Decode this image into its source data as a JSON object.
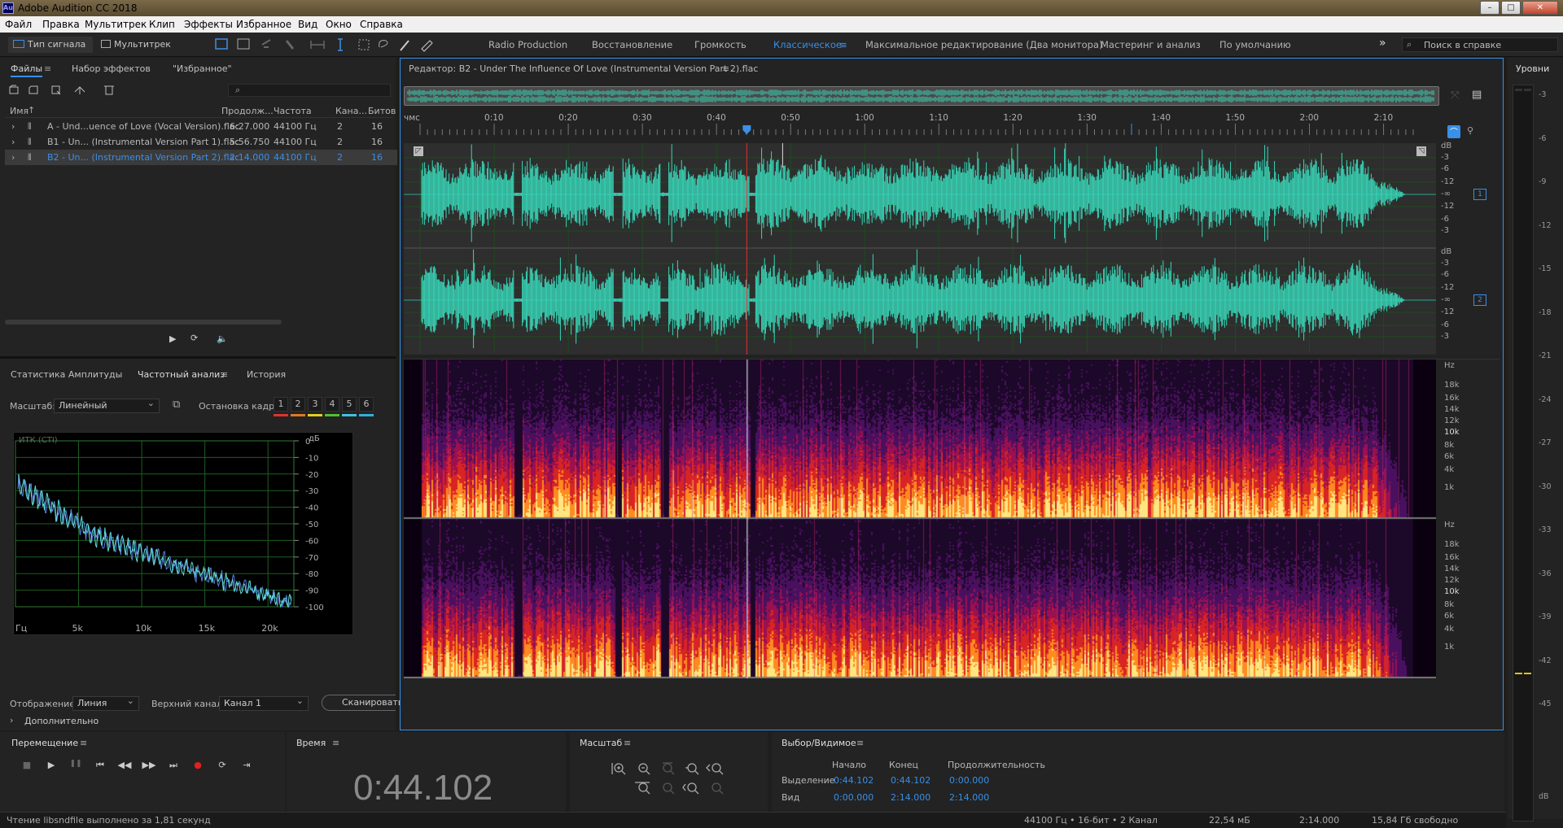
{
  "window": {
    "title": "Adobe Audition CC 2018",
    "app_icon": "Au",
    "buttons": [
      "–",
      "□",
      "✕"
    ]
  },
  "menu": [
    "Файл",
    "Правка",
    "Мультитрек",
    "Клип",
    "Эффекты",
    "Избранное",
    "Вид",
    "Окно",
    "Справка"
  ],
  "toolbar": {
    "waveform_label": "Тип сигнала",
    "multitrack_label": "Мультитрек",
    "workspaces": [
      "Radio Production",
      "Восстановление",
      "Громкость",
      "Классическое",
      "Максимальное редактирование (Два монитора)",
      "Мастеринг и анализ",
      "По умолчанию"
    ],
    "active_workspace": "Классическое",
    "overflow": "»",
    "search_placeholder": "Поиск в справке"
  },
  "files_panel": {
    "tabs": [
      "Файлы",
      "Набор эффектов",
      "\"Избранное\""
    ],
    "columns": [
      "Имя",
      "Продолж...",
      "Частота",
      "Кана...",
      "Битов"
    ],
    "rows": [
      {
        "name": "A - Und...uence of Love (Vocal Version).flac",
        "duration": "6:27.000",
        "rate": "44100 Гц",
        "channels": "2",
        "bits": "16"
      },
      {
        "name": "B1 - Un... (Instrumental Version Part 1).flac",
        "duration": "5:56.750",
        "rate": "44100 Гц",
        "channels": "2",
        "bits": "16"
      },
      {
        "name": "B2 - Un... (Instrumental Version Part 2).flac",
        "duration": "2:14.000",
        "rate": "44100 Гц",
        "channels": "2",
        "bits": "16"
      }
    ],
    "selected_row": 2,
    "search_icon": "⌕"
  },
  "analysis_panel": {
    "tabs": [
      "Статистика Амплитуды",
      "Частотный анализ",
      "История"
    ],
    "active_tab": "Частотный анализ",
    "scale_label": "Масштаб:",
    "scale_value": "Линейный",
    "freeze_label": "Остановка кадра:",
    "freeze_buttons": [
      "1",
      "2",
      "3",
      "4",
      "5",
      "6"
    ],
    "freeze_colors": [
      "#e03030",
      "#e07820",
      "#e0d020",
      "#50c030",
      "#40c0e0",
      "#30b0e0"
    ],
    "graph_label": "ИТК (CTI)",
    "db_label": "дБ",
    "db_ticks": [
      "0",
      "-10",
      "-20",
      "-30",
      "-40",
      "-50",
      "-60",
      "-70",
      "-80",
      "-90",
      "-100"
    ],
    "hz_ticks": [
      "Гц",
      "5k",
      "10k",
      "15k",
      "20k"
    ],
    "display_label": "Отображение:",
    "display_value": "Линия",
    "channel_label": "Верхний канал:",
    "channel_value": "Канал 1",
    "scan_button": "Сканировать",
    "more_label": "Дополнительно"
  },
  "editor": {
    "title": "Редактор: B2 - Under The Influence Of Love (Instrumental Version Part 2).flac",
    "time_ticks": [
      "чмс",
      "0:10",
      "0:20",
      "0:30",
      "0:40",
      "0:50",
      "1:00",
      "1:10",
      "1:20",
      "1:30",
      "1:40",
      "1:50",
      "2:00",
      "2:10"
    ],
    "db_ticks": [
      "dB",
      "-3",
      "-6",
      "-12",
      "-∞",
      "-12",
      "-6",
      "-3"
    ],
    "channels": [
      "1",
      "2"
    ],
    "hz_ticks": [
      "Hz",
      "18k",
      "16k",
      "14k",
      "12k",
      "10k",
      "8k",
      "6k",
      "4k",
      "1k"
    ],
    "playhead_fraction": 0.329,
    "waveform_color": "#38d6b8"
  },
  "levels": {
    "title": "Уровни",
    "ticks": [
      "-3",
      "-6",
      "-9",
      "-12",
      "-15",
      "-18",
      "-21",
      "-24",
      "-27",
      "-30",
      "-33",
      "-36",
      "-39",
      "-42",
      "-45",
      "dB"
    ]
  },
  "transport": {
    "title": "Перемещение",
    "buttons": [
      "stop-icon",
      "play-icon",
      "pause-icon",
      "go-start-icon",
      "rewind-icon",
      "forward-icon",
      "go-end-icon",
      "record-icon",
      "loop-icon",
      "skip-selection-icon"
    ]
  },
  "time": {
    "title": "Время",
    "value": "0:44.102"
  },
  "zoom": {
    "title": "Масштаб"
  },
  "selection": {
    "title": "Выбор/Видимое",
    "headers": [
      "Начало",
      "Конец",
      "Продолжительность"
    ],
    "rows": [
      {
        "label": "Выделение",
        "start": "0:44.102",
        "end": "0:44.102",
        "duration": "0:00.000"
      },
      {
        "label": "Вид",
        "start": "0:00.000",
        "end": "2:14.000",
        "duration": "2:14.000"
      }
    ]
  },
  "status": {
    "left": "Чтение libsndfile выполнено за 1,81 секунд",
    "format": "44100 Гц • 16-бит • 2 Канал",
    "size": "22,54 мБ",
    "duration": "2:14.000",
    "free": "15,84 Гб свободно"
  }
}
